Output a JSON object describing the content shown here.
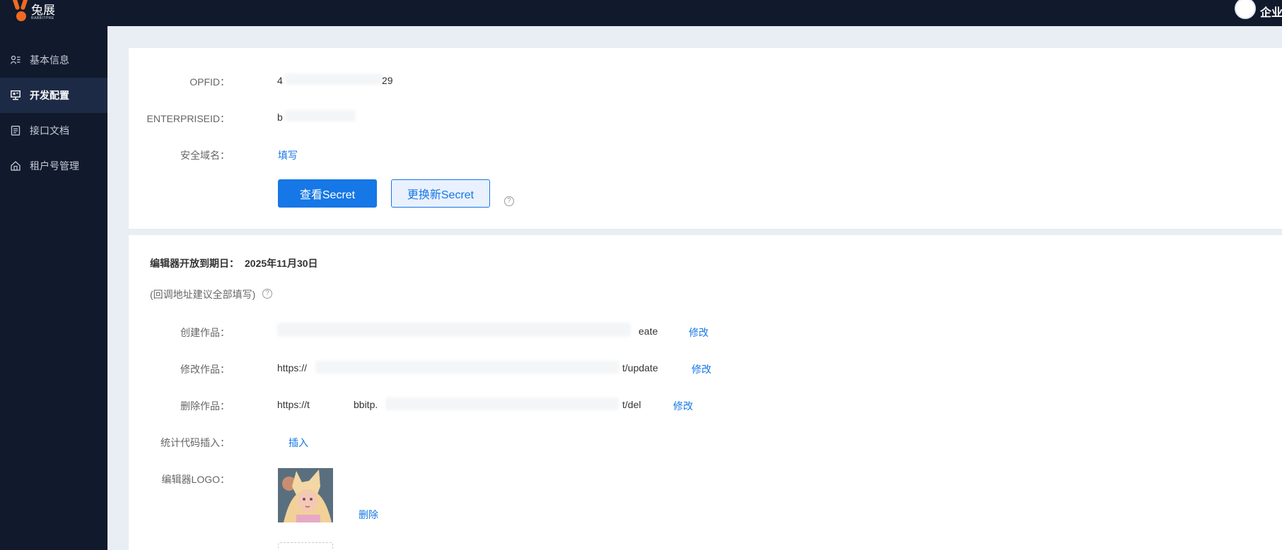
{
  "header": {
    "logo_cn": "兔展",
    "logo_en": "RABBITPRE",
    "user_label": "企业"
  },
  "sidebar": {
    "items": [
      {
        "label": "基本信息",
        "icon": "user-profile-icon"
      },
      {
        "label": "开发配置",
        "icon": "monitor-config-icon"
      },
      {
        "label": "接口文档",
        "icon": "document-icon"
      },
      {
        "label": "租户号管理",
        "icon": "home-icon"
      }
    ],
    "active_index": 1
  },
  "config": {
    "opfid_label": "OPFID：",
    "opfid_value_prefix": "4",
    "opfid_value_suffix": "29",
    "enterpriseid_label": "ENTERPRISEID：",
    "enterpriseid_value": "b",
    "domain_label": "安全域名：",
    "domain_link": "填写",
    "view_secret_button": "查看Secret",
    "renew_secret_button": "更换新Secret",
    "help_glyph": "?"
  },
  "editor": {
    "expiry_label": "编辑器开放到期日：",
    "expiry_date": "2025年11月30日",
    "callback_hint": "(回调地址建议全部填写)",
    "create_label": "创建作品：",
    "create_value_suffix": "eate",
    "create_edit": "修改",
    "update_label": "修改作品：",
    "update_value_prefix": "https://",
    "update_value_suffix": "t/update",
    "update_edit": "修改",
    "delete_label": "删除作品：",
    "delete_value_prefix": "https://t",
    "delete_value_mid": "bbitp.",
    "delete_value_suffix": "t/del",
    "delete_edit": "修改",
    "stats_label": "统计代码插入：",
    "stats_link": "插入",
    "logo_label": "编辑器LOGO：",
    "logo_delete": "删除"
  },
  "colors": {
    "accent": "#1677e6",
    "sidebar_bg": "#111a2c",
    "page_bg": "#e9edf4"
  }
}
